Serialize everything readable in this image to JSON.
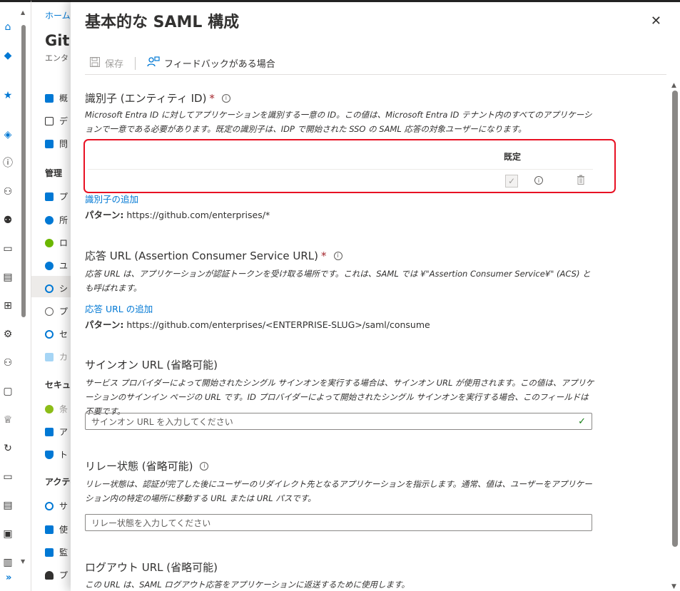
{
  "rail": {
    "icons": [
      "home-icon",
      "dashboard-icon",
      "favorites-star-icon",
      "cloud-icon",
      "info-icon",
      "user-icon",
      "group-icon",
      "devices-icon",
      "apps-icon",
      "cube-icon",
      "roles-icon",
      "admin-icon",
      "card-icon",
      "trophy-icon",
      "sync-icon",
      "terminal-icon",
      "logs-icon",
      "monitor-icon",
      "book-icon"
    ],
    "expand_label": "»"
  },
  "background": {
    "breadcrumb": "ホーム",
    "title": "Gitl",
    "subtitle": "エンタ",
    "nav": [
      {
        "label": "概",
        "color": "#0078d4"
      },
      {
        "label": "デ",
        "color": "#323130"
      },
      {
        "label": "問",
        "color": "#0078d4"
      }
    ],
    "header_manage": "管理",
    "manage_items": [
      {
        "label": "プ",
        "color": "#0078d4"
      },
      {
        "label": "所",
        "color": "#0078d4"
      },
      {
        "label": "ロ",
        "color": "#6bb700"
      },
      {
        "label": "ユ",
        "color": "#0078d4"
      },
      {
        "label": "シ",
        "color": "#0078d4"
      },
      {
        "label": "プ",
        "color": "#605e5c"
      },
      {
        "label": "セ",
        "color": "#0078d4"
      },
      {
        "label": "カ",
        "color": "#a6d5f5"
      }
    ],
    "header_security": "セキュリ",
    "security_items": [
      {
        "label": "条",
        "color": "#8cbd18"
      },
      {
        "label": "ア",
        "color": "#0078d4"
      },
      {
        "label": "ト",
        "color": "#0078d4"
      }
    ],
    "header_activity": "アクティ",
    "activity_items": [
      {
        "label": "サ",
        "color": "#0078d4"
      },
      {
        "label": "使",
        "color": "#0078d4"
      },
      {
        "label": "監",
        "color": "#0078d4"
      },
      {
        "label": "プ",
        "color": "#323130"
      }
    ]
  },
  "panel": {
    "title": "基本的な SAML 構成",
    "close_label": "✕",
    "toolbar": {
      "save_label": "保存",
      "feedback_label": "フィードバックがある場合"
    },
    "identifier": {
      "title": "識別子 (エンティティ ID)",
      "required": "*",
      "description": "Microsoft Entra ID に対してアプリケーションを識別する一意の ID。この値は、Microsoft Entra ID テナント内のすべてのアプリケーションで一意である必要があります。既定の識別子は、IDP で開始された SSO の SAML 応答の対象ユーザーになります。",
      "column_default": "既定",
      "add_link": "識別子の追加",
      "pattern_label": "パターン:",
      "pattern_value": "https://github.com/enterprises/*"
    },
    "reply_url": {
      "title": "応答 URL (Assertion Consumer Service URL)",
      "required": "*",
      "description": "応答 URL は、アプリケーションが認証トークンを受け取る場所です。これは、SAML では ¥\"Assertion Consumer Service¥\" (ACS) とも呼ばれます。",
      "add_link": "応答 URL の追加",
      "pattern_label": "パターン:",
      "pattern_value": "https://github.com/enterprises/<ENTERPRISE-SLUG>/saml/consume"
    },
    "signon_url": {
      "title": "サインオン URL (省略可能)",
      "description": "サービス プロバイダーによって開始されたシングル サインオンを実行する場合は、サインオン URL が使用されます。この値は、アプリケーションのサインイン ページの URL です。ID プロバイダーによって開始されたシングル サインオンを実行する場合、このフィールドは不要です。",
      "placeholder": "サインオン URL を入力してください"
    },
    "relay_state": {
      "title": "リレー状態 (省略可能)",
      "description": "リレー状態は、認証が完了した後にユーザーのリダイレクト先となるアプリケーションを指示します。通常、値は、ユーザーをアプリケーション内の特定の場所に移動する URL または URL パスです。",
      "placeholder": "リレー状態を入力してください"
    },
    "logout_url": {
      "title": "ログアウト URL (省略可能)",
      "description": "この URL は、SAML ログアウト応答をアプリケーションに返送するために使用します。"
    }
  }
}
